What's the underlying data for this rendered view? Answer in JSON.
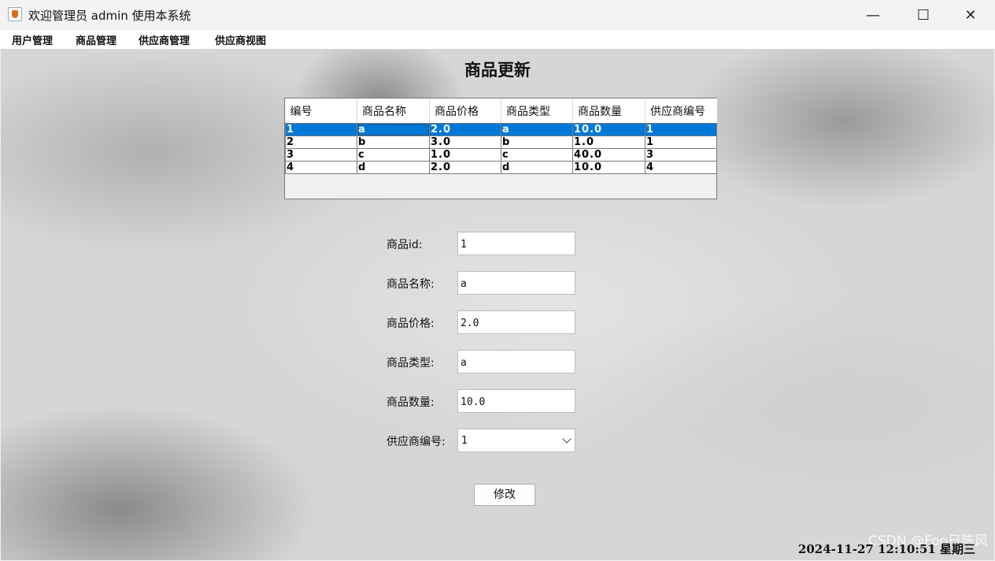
{
  "window": {
    "title": "欢迎管理员 admin 使用本系统",
    "min_glyph": "—",
    "max_glyph": "☐",
    "close_glyph": "✕"
  },
  "menu": {
    "items": [
      "用户管理",
      "商品管理",
      "供应商管理",
      "供应商视图"
    ]
  },
  "page": {
    "heading": "商品更新"
  },
  "table": {
    "columns": [
      "编号",
      "商品名称",
      "商品价格",
      "商品类型",
      "商品数量",
      "供应商编号"
    ],
    "rows": [
      [
        "1",
        "a",
        "2.0",
        "a",
        "10.0",
        "1"
      ],
      [
        "2",
        "b",
        "3.0",
        "b",
        "1.0",
        "1"
      ],
      [
        "3",
        "c",
        "1.0",
        "c",
        "40.0",
        "3"
      ],
      [
        "4",
        "d",
        "2.0",
        "d",
        "10.0",
        "4"
      ]
    ],
    "selected_row": 0
  },
  "form": {
    "id_label": "商品id:",
    "id_value": "1",
    "name_label": "商品名称:",
    "name_value": "a",
    "price_label": "商品价格:",
    "price_value": "2.0",
    "type_label": "商品类型:",
    "type_value": "a",
    "quantity_label": "商品数量:",
    "quantity_value": "10.0",
    "supplier_label": "供应商编号:",
    "supplier_value": "1",
    "submit_label": "修改"
  },
  "status": {
    "clock": "2024-11-27 12:10:51 星期三"
  },
  "watermark": "CSDN @Foo日陈风",
  "colors": {
    "selection": "#0078d7",
    "menu_bg": "#ffffff",
    "titlebar_bg": "#f3f3f3"
  }
}
